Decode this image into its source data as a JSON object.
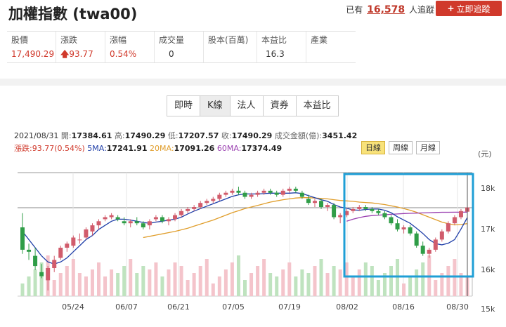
{
  "header": {
    "title": "加權指數 (twa00)",
    "follow_prefix": "已有",
    "follow_count": "16,578",
    "follow_suffix": "人追蹤",
    "follow_button": "立即追蹤"
  },
  "stats": [
    {
      "label": "股價",
      "value": "17,490.29",
      "color": "red"
    },
    {
      "label": "漲跌",
      "value": "93.77",
      "color": "red",
      "arrow": true
    },
    {
      "label": "漲幅",
      "value": "0.54%",
      "color": "red"
    },
    {
      "label": "成交量",
      "value": "0",
      "color": "black"
    },
    {
      "label": "股本(百萬)",
      "value": "",
      "color": "black"
    },
    {
      "label": "本益比",
      "value": "16.3",
      "color": "black"
    },
    {
      "label": "產業",
      "value": "",
      "color": "black"
    }
  ],
  "tabs": [
    {
      "label": "即時",
      "active": false
    },
    {
      "label": "K線",
      "active": true
    },
    {
      "label": "法人",
      "active": false
    },
    {
      "label": "資券",
      "active": false
    },
    {
      "label": "本益比",
      "active": false
    }
  ],
  "info": {
    "date": "2021/08/31",
    "open_label": "開:",
    "open": "17384.61",
    "high_label": "高:",
    "high": "17490.29",
    "low_label": "低:",
    "low": "17207.57",
    "close_label": "收:",
    "close": "17490.29",
    "amount_label": "成交金額(億):",
    "amount": "3451.42",
    "change_label": "漲跌:",
    "change": "93.77(0.54%)",
    "ma5_label": "5MA:",
    "ma5": "17241.91",
    "ma20_label": "20MA:",
    "ma20": "17091.26",
    "ma60_label": "60MA:",
    "ma60": "17374.49"
  },
  "periods": [
    {
      "label": "日線",
      "active": true
    },
    {
      "label": "周線",
      "active": false
    },
    {
      "label": "月線",
      "active": false
    }
  ],
  "chart_data": {
    "type": "candlestick",
    "unit_label": "(元)",
    "y_ticks": [
      "18k",
      "17k",
      "16k",
      "15k"
    ],
    "ylim": [
      15000,
      18400
    ],
    "x_ticks": [
      "05/24",
      "06/07",
      "06/21",
      "07/05",
      "07/19",
      "08/02",
      "08/16",
      "08/30"
    ],
    "colors": {
      "up": "#d15c6c",
      "down": "#2f9d47",
      "ma5": "#1f3ea8",
      "ma20": "#e09e2c",
      "ma60": "#9a3fb0",
      "volume": "#bfe3bf",
      "volume_up": "#f4c4cb",
      "highlight": "#1f9fd6"
    },
    "candles": [
      [
        17000,
        17350,
        16350,
        16450
      ],
      [
        16450,
        16600,
        16200,
        16400
      ],
      [
        16300,
        16500,
        15950,
        16050
      ],
      [
        15900,
        16100,
        15750,
        15800
      ],
      [
        15700,
        16050,
        15450,
        16000
      ],
      [
        16000,
        16300,
        15900,
        16200
      ],
      [
        16250,
        16550,
        16200,
        16500
      ],
      [
        16500,
        16650,
        16400,
        16600
      ],
      [
        16550,
        16800,
        16500,
        16750
      ],
      [
        16700,
        16850,
        16600,
        16700
      ],
      [
        16750,
        17000,
        16700,
        16950
      ],
      [
        16900,
        17100,
        16800,
        17050
      ],
      [
        17050,
        17200,
        16950,
        17150
      ],
      [
        17200,
        17300,
        17150,
        17250
      ],
      [
        17250,
        17350,
        17200,
        17300
      ],
      [
        17250,
        17300,
        17150,
        17200
      ],
      [
        17150,
        17250,
        17050,
        17100
      ],
      [
        17100,
        17200,
        17000,
        17150
      ],
      [
        17150,
        17250,
        17050,
        17100
      ],
      [
        17100,
        17150,
        16950,
        17000
      ],
      [
        17050,
        17200,
        16950,
        17150
      ],
      [
        17200,
        17300,
        17150,
        17250
      ],
      [
        17250,
        17300,
        17100,
        17150
      ],
      [
        17150,
        17250,
        17050,
        17200
      ],
      [
        17200,
        17350,
        17150,
        17300
      ],
      [
        17300,
        17450,
        17250,
        17400
      ],
      [
        17400,
        17500,
        17350,
        17450
      ],
      [
        17450,
        17550,
        17400,
        17500
      ],
      [
        17500,
        17650,
        17450,
        17600
      ],
      [
        17600,
        17700,
        17550,
        17650
      ],
      [
        17650,
        17750,
        17600,
        17700
      ],
      [
        17700,
        17850,
        17650,
        17800
      ],
      [
        17800,
        17900,
        17750,
        17850
      ],
      [
        17850,
        17950,
        17800,
        17900
      ],
      [
        17900,
        18000,
        17800,
        17850
      ],
      [
        17850,
        17900,
        17700,
        17750
      ],
      [
        17750,
        17850,
        17700,
        17800
      ],
      [
        17800,
        17900,
        17750,
        17850
      ],
      [
        17850,
        17950,
        17800,
        17900
      ],
      [
        17900,
        17950,
        17800,
        17850
      ],
      [
        17850,
        17900,
        17750,
        17800
      ],
      [
        17800,
        17950,
        17750,
        17900
      ],
      [
        17900,
        18000,
        17850,
        17950
      ],
      [
        17950,
        18000,
        17850,
        17900
      ],
      [
        17850,
        17900,
        17700,
        17750
      ],
      [
        17700,
        17800,
        17550,
        17600
      ],
      [
        17600,
        17700,
        17500,
        17650
      ],
      [
        17650,
        17700,
        17450,
        17500
      ],
      [
        17500,
        17600,
        17400,
        17550
      ],
      [
        17550,
        17600,
        17200,
        17250
      ],
      [
        17250,
        17350,
        17100,
        17300
      ],
      [
        17300,
        17450,
        17250,
        17400
      ],
      [
        17400,
        17500,
        17350,
        17450
      ],
      [
        17450,
        17550,
        17400,
        17500
      ],
      [
        17500,
        17550,
        17400,
        17450
      ],
      [
        17450,
        17500,
        17350,
        17400
      ],
      [
        17400,
        17450,
        17300,
        17350
      ],
      [
        17350,
        17400,
        17200,
        17250
      ],
      [
        17250,
        17300,
        17050,
        17100
      ],
      [
        17100,
        17200,
        16900,
        16950
      ],
      [
        16950,
        17050,
        16850,
        17000
      ],
      [
        17000,
        17050,
        16800,
        16850
      ],
      [
        16850,
        16900,
        16500,
        16550
      ],
      [
        16550,
        16650,
        16300,
        16350
      ],
      [
        16350,
        16500,
        16250,
        16450
      ],
      [
        16450,
        16750,
        16400,
        16700
      ],
      [
        16700,
        16950,
        16650,
        16900
      ],
      [
        16900,
        17150,
        16850,
        17100
      ],
      [
        17100,
        17300,
        17050,
        17250
      ],
      [
        17250,
        17450,
        17200,
        17400
      ],
      [
        17384.61,
        17490.29,
        17207.57,
        17490.29
      ]
    ],
    "ma5": [
      16900,
      16700,
      16500,
      16300,
      16150,
      16100,
      16150,
      16250,
      16400,
      16550,
      16700,
      16800,
      16950,
      17050,
      17150,
      17200,
      17200,
      17180,
      17150,
      17120,
      17100,
      17130,
      17150,
      17180,
      17200,
      17250,
      17330,
      17400,
      17460,
      17520,
      17580,
      17640,
      17700,
      17760,
      17800,
      17820,
      17820,
      17820,
      17830,
      17840,
      17840,
      17840,
      17840,
      17850,
      17830,
      17780,
      17730,
      17680,
      17640,
      17560,
      17500,
      17470,
      17430,
      17420,
      17440,
      17450,
      17450,
      17420,
      17360,
      17260,
      17180,
      17100,
      16980,
      16850,
      16700,
      16600,
      16570,
      16610,
      16700,
      16960,
      17241.91
    ],
    "ma20": [
      null,
      null,
      null,
      null,
      null,
      null,
      null,
      null,
      null,
      null,
      null,
      null,
      null,
      null,
      null,
      null,
      null,
      null,
      null,
      16750,
      16780,
      16810,
      16840,
      16870,
      16900,
      16940,
      16980,
      17030,
      17080,
      17130,
      17180,
      17240,
      17300,
      17360,
      17410,
      17460,
      17500,
      17540,
      17580,
      17620,
      17650,
      17680,
      17700,
      17720,
      17730,
      17730,
      17720,
      17710,
      17700,
      17680,
      17660,
      17650,
      17640,
      17620,
      17610,
      17600,
      17580,
      17560,
      17530,
      17500,
      17460,
      17420,
      17370,
      17310,
      17250,
      17190,
      17130,
      17090,
      17060,
      17070,
      17091.26
    ],
    "ma60": [
      null,
      null,
      null,
      null,
      null,
      null,
      null,
      null,
      null,
      null,
      null,
      null,
      null,
      null,
      null,
      null,
      null,
      null,
      null,
      null,
      null,
      null,
      null,
      null,
      null,
      null,
      null,
      null,
      null,
      null,
      null,
      null,
      null,
      null,
      null,
      null,
      null,
      null,
      null,
      null,
      null,
      null,
      null,
      null,
      null,
      null,
      null,
      null,
      null,
      null,
      null,
      17150,
      17200,
      17240,
      17270,
      17290,
      17300,
      17310,
      17320,
      17330,
      17340,
      17345,
      17350,
      17355,
      17360,
      17365,
      17370,
      17370,
      17372,
      17373,
      17374.49
    ]
  }
}
